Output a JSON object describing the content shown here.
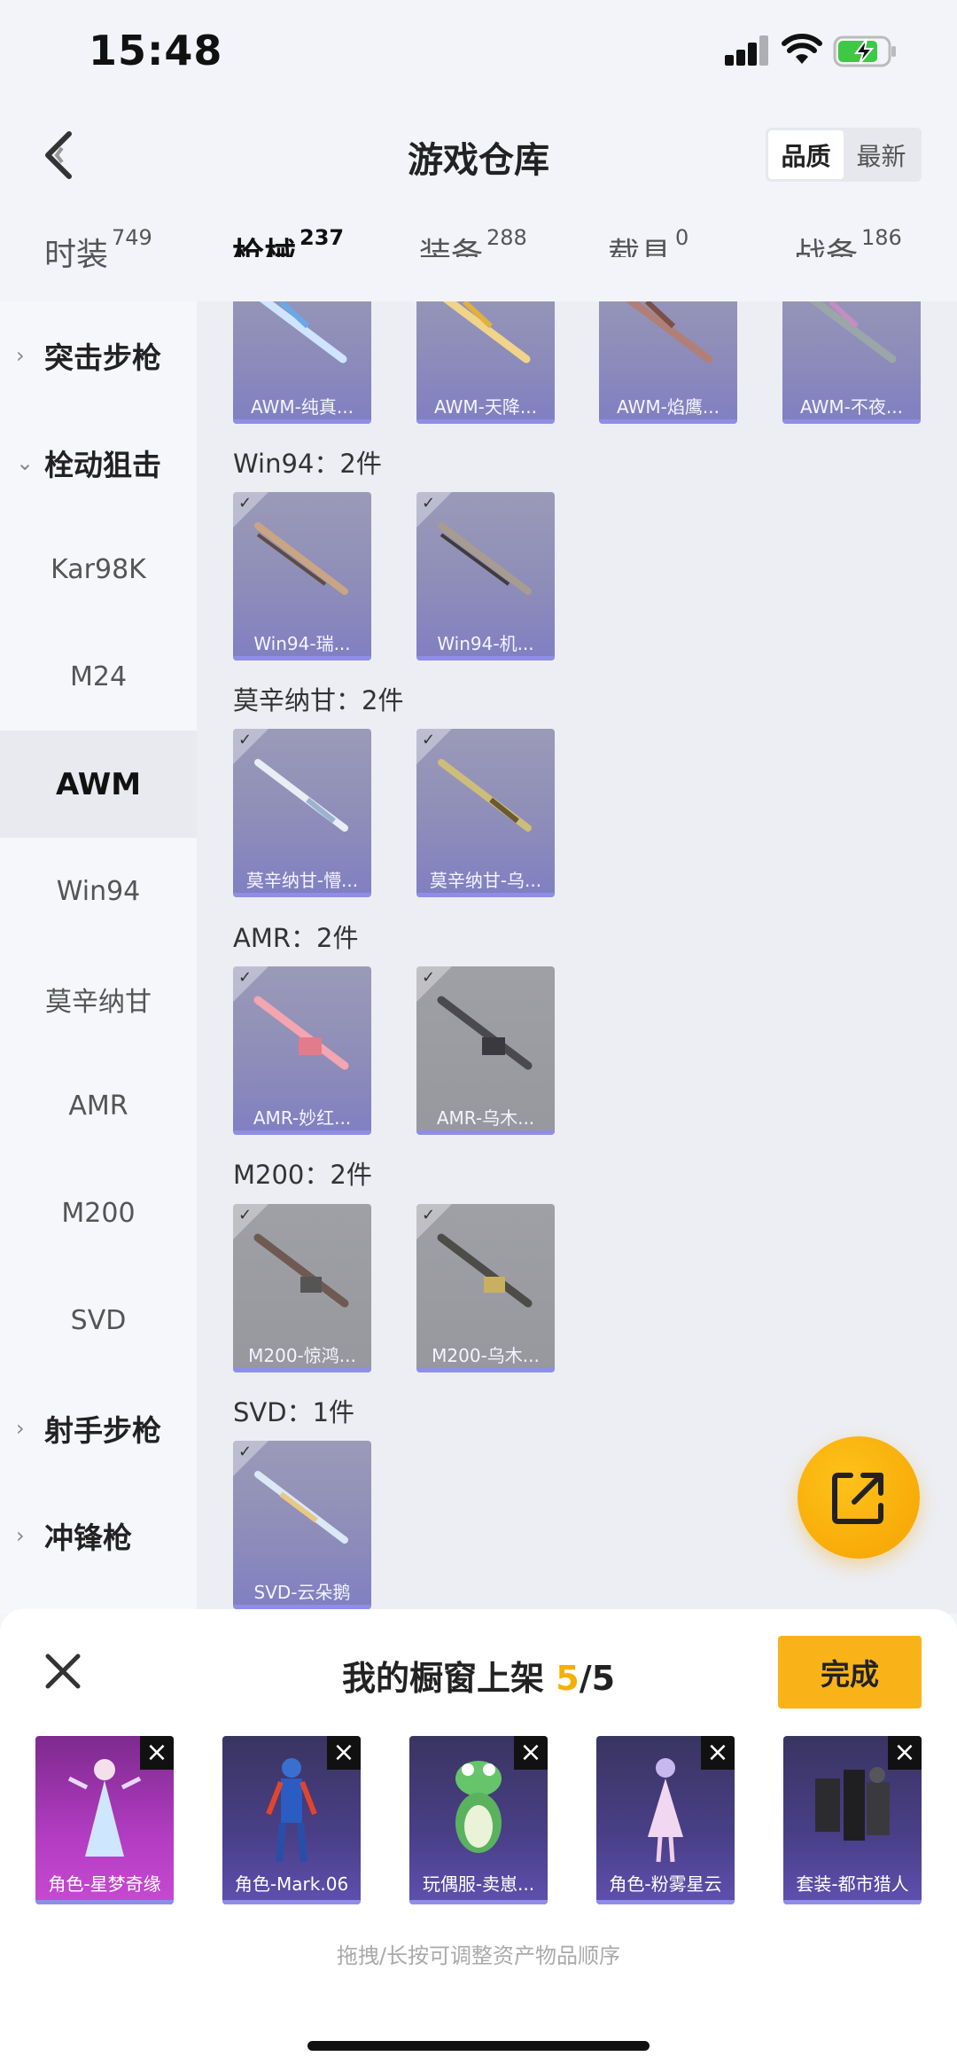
{
  "status": {
    "time": "15:48"
  },
  "header": {
    "title": "游戏仓库",
    "sort_options": [
      "品质",
      "最新"
    ],
    "sort_active": "品质"
  },
  "tabs": [
    {
      "label": "时装",
      "count": "749"
    },
    {
      "label": "枪械",
      "count": "237"
    },
    {
      "label": "装备",
      "count": "288"
    },
    {
      "label": "载具",
      "count": "0"
    },
    {
      "label": "战备",
      "count": "186"
    }
  ],
  "active_tab": "枪械",
  "sidebar": {
    "items": [
      {
        "label": "突击步枪",
        "type": "category",
        "expanded": false
      },
      {
        "label": "栓动狙击",
        "type": "category",
        "expanded": true
      },
      {
        "label": "Kar98K",
        "type": "sub"
      },
      {
        "label": "M24",
        "type": "sub"
      },
      {
        "label": "AWM",
        "type": "sub",
        "active": true
      },
      {
        "label": "Win94",
        "type": "sub"
      },
      {
        "label": "莫辛纳甘",
        "type": "sub"
      },
      {
        "label": "AMR",
        "type": "sub"
      },
      {
        "label": "M200",
        "type": "sub"
      },
      {
        "label": "SVD",
        "type": "sub"
      },
      {
        "label": "射手步枪",
        "type": "category",
        "expanded": false
      },
      {
        "label": "冲锋枪",
        "type": "category",
        "expanded": false
      }
    ]
  },
  "content": {
    "awm_row": [
      "AWM-纯真...",
      "AWM-天降...",
      "AWM-焰鹰...",
      "AWM-不夜..."
    ],
    "groups": [
      {
        "title": "Win94：2件",
        "items": [
          {
            "name": "Win94-瑞...",
            "tone": "purple"
          },
          {
            "name": "Win94-机...",
            "tone": "purple"
          }
        ]
      },
      {
        "title": "莫辛纳甘：2件",
        "items": [
          {
            "name": "莫辛纳甘-懵...",
            "tone": "purple"
          },
          {
            "name": "莫辛纳甘-乌...",
            "tone": "purple"
          }
        ]
      },
      {
        "title": "AMR：2件",
        "items": [
          {
            "name": "AMR-妙红...",
            "tone": "purple"
          },
          {
            "name": "AMR-乌木...",
            "tone": "grey"
          }
        ]
      },
      {
        "title": "M200：2件",
        "items": [
          {
            "name": "M200-惊鸿...",
            "tone": "grey"
          },
          {
            "name": "M200-乌木...",
            "tone": "grey"
          }
        ]
      },
      {
        "title": "SVD：1件",
        "items": [
          {
            "name": "SVD-云朵鹅",
            "tone": "purple"
          }
        ]
      }
    ]
  },
  "sheet": {
    "title_prefix": "我的橱窗上架",
    "count": "5",
    "total": "/5",
    "done_label": "完成",
    "items": [
      "角色-星梦奇缘",
      "角色-Mark.06",
      "玩偶服-卖崽...",
      "角色-粉雾星云",
      "套装-都市猎人"
    ],
    "hint": "拖拽/长按可调整资产物品顺序"
  },
  "colors": {
    "accent": "#f9b319",
    "highlight": "#f5b000",
    "card_bar": "#8e8ee8"
  }
}
